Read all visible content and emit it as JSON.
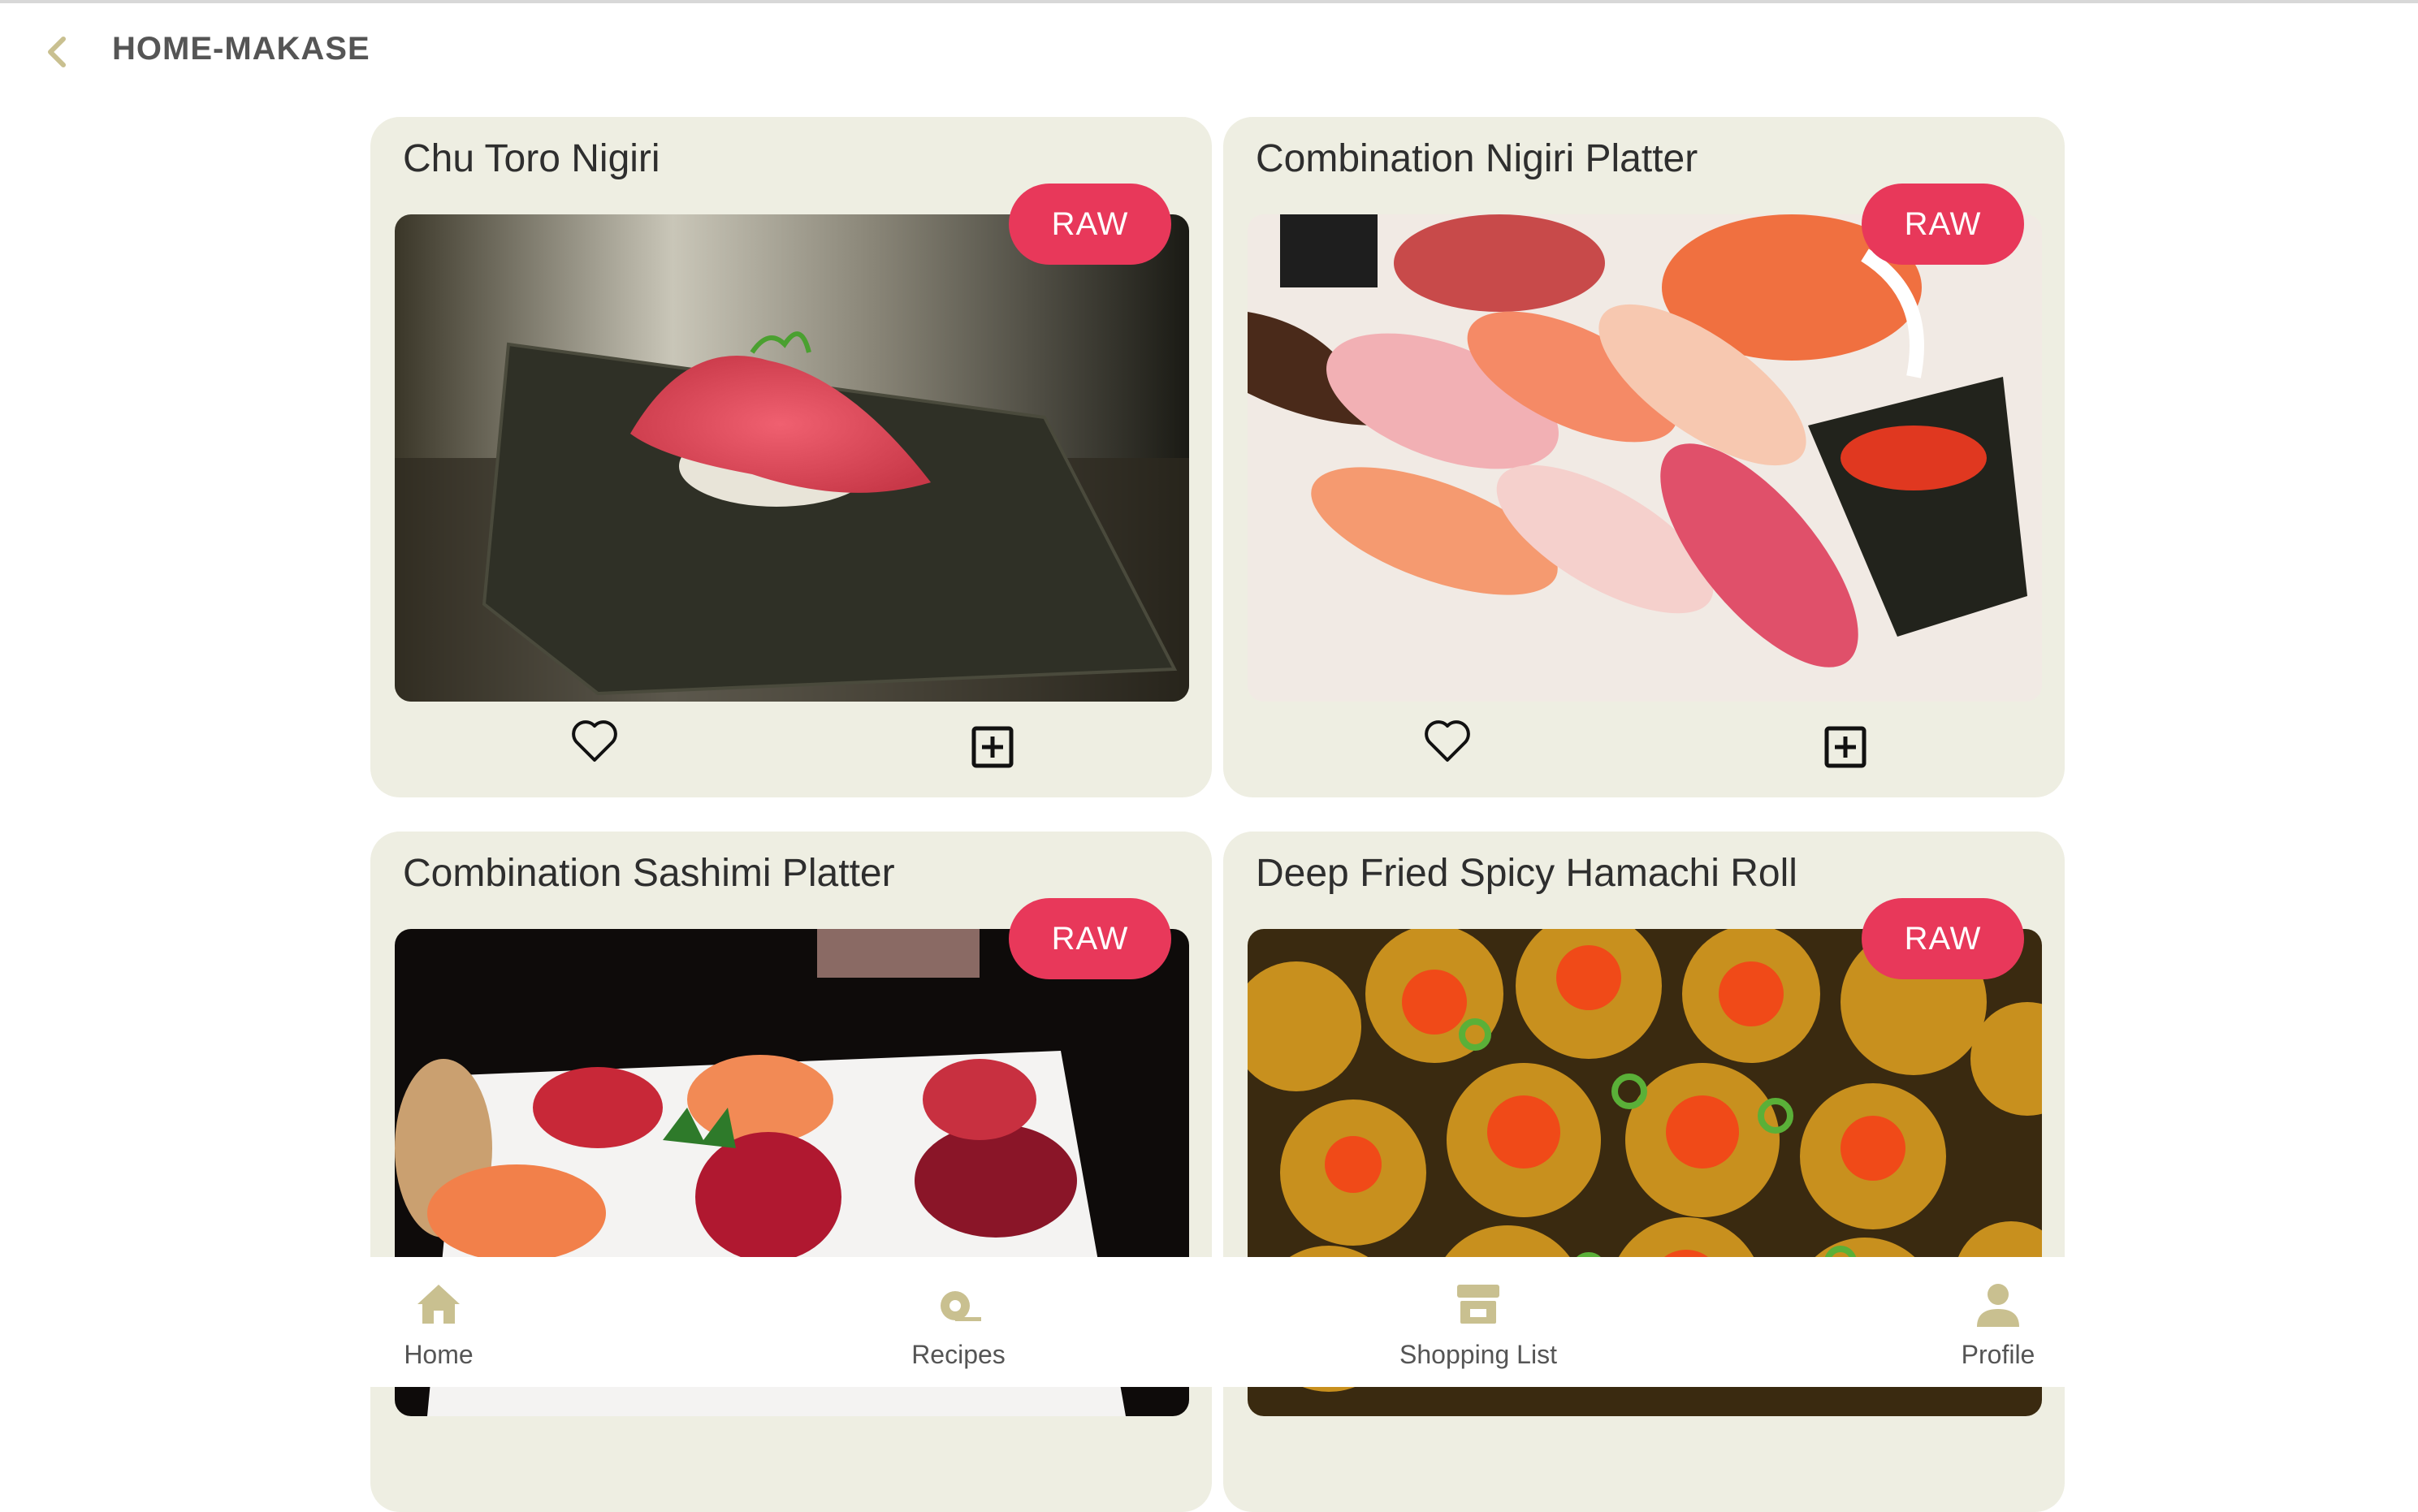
{
  "header": {
    "title": "HOME-MAKASE",
    "back_icon": "chevron-left-icon"
  },
  "colors": {
    "accent": "#c9c090",
    "badge": "#e8385a",
    "card_bg": "#eeeee2"
  },
  "cards": [
    {
      "title": "Chu Toro Nigiri",
      "badge": "RAW"
    },
    {
      "title": "Combination Nigiri Platter",
      "badge": "RAW"
    },
    {
      "title": "Combination Sashimi Platter",
      "badge": "RAW"
    },
    {
      "title": "Deep Fried Spicy Hamachi Roll",
      "badge": "RAW"
    }
  ],
  "nav": {
    "home": "Home",
    "recipes": "Recipes",
    "shopping": "Shopping List",
    "profile": "Profile"
  }
}
